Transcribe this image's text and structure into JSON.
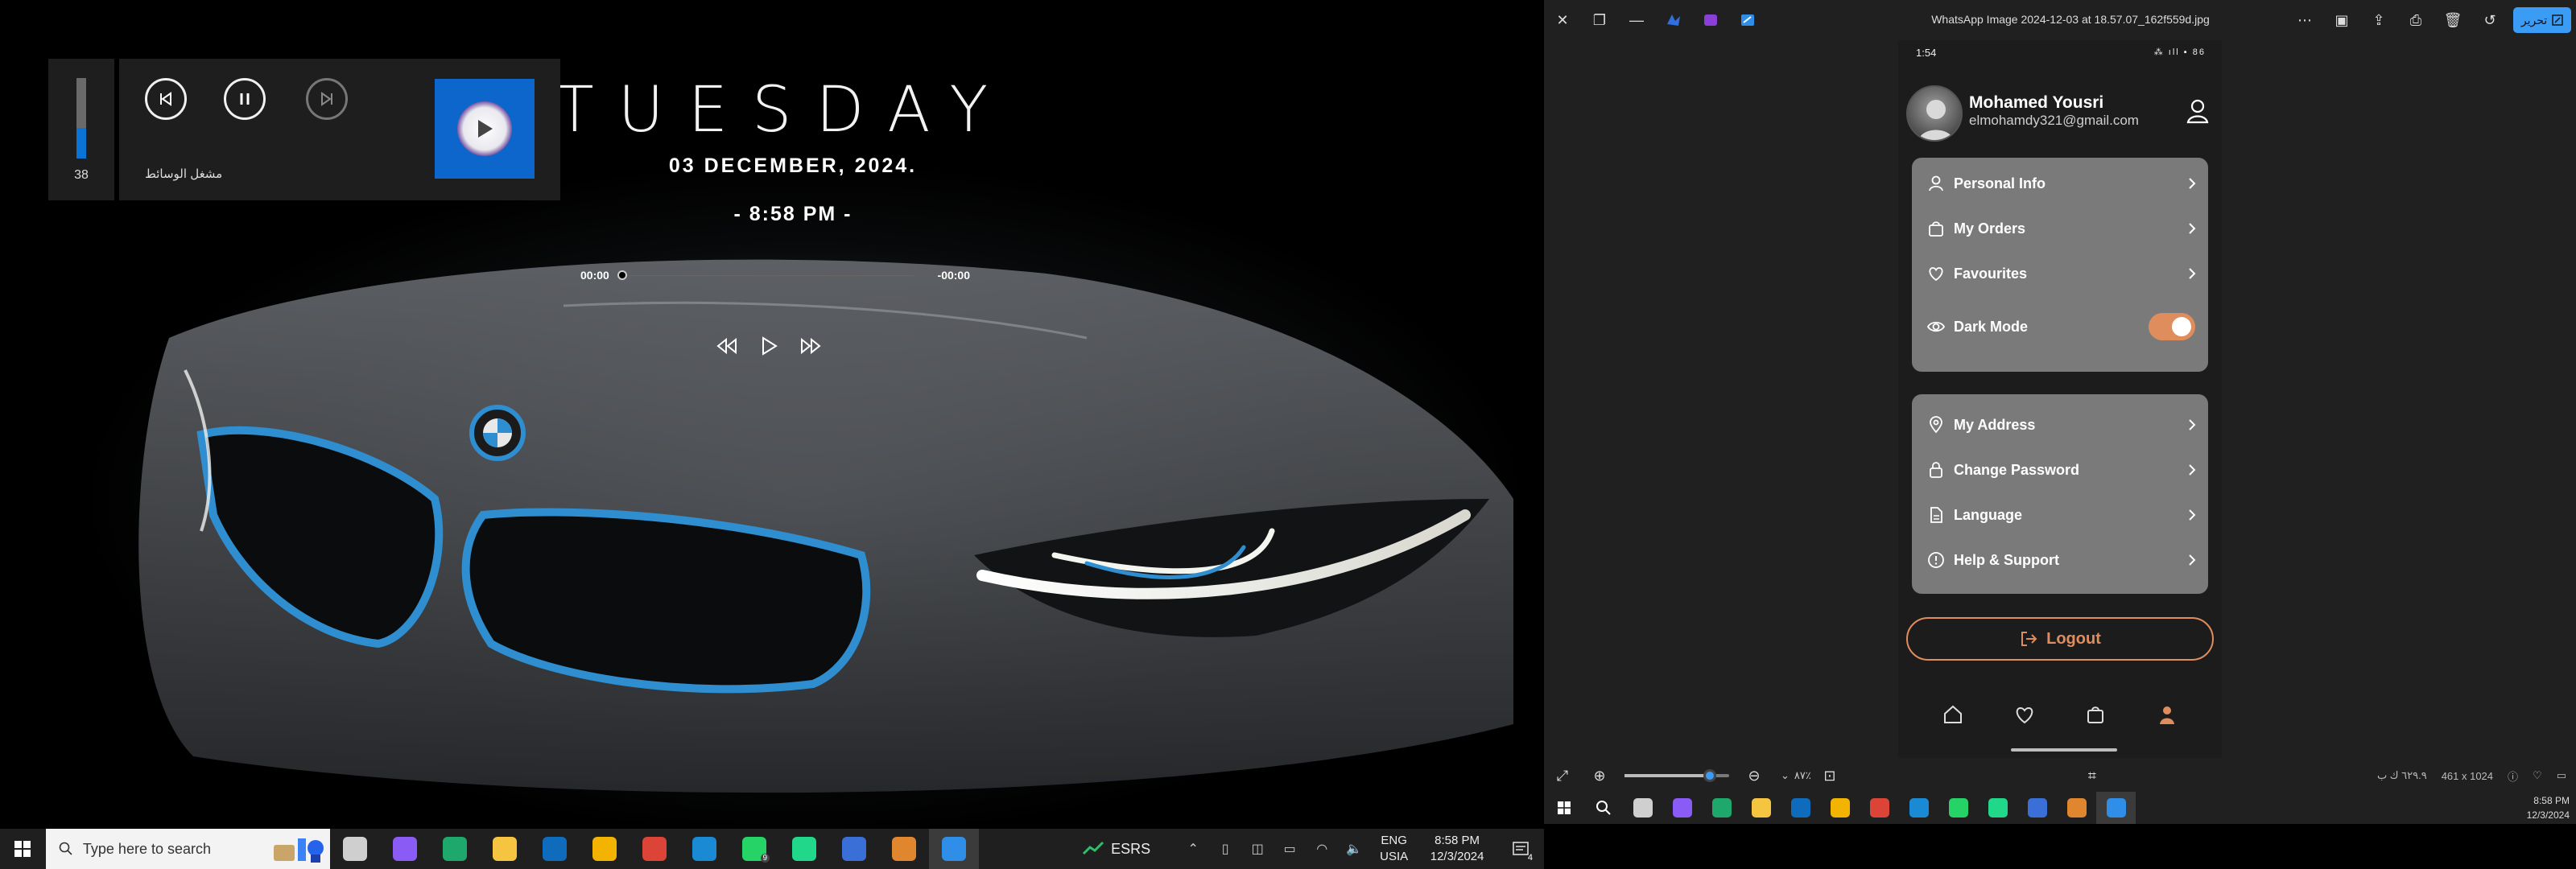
{
  "left_screen": {
    "clock": {
      "day": "TUESDAY",
      "date": "03 DECEMBER, 2024.",
      "time": "- 8:58 PM -"
    },
    "music_widget": {
      "elapsed": "00:00",
      "remaining": "-00:00",
      "progress": 0,
      "controls": [
        "rewind-icon",
        "play-icon",
        "fast-forward-icon"
      ]
    },
    "media_flyout": {
      "volume": "38",
      "volume_fraction": 0.38,
      "label": "مشغل الوسائط",
      "buttons": [
        "previous-icon",
        "pause-icon",
        "next-icon"
      ],
      "accent": "#0d66cc"
    },
    "taskbar": {
      "search_placeholder": "Type here to search",
      "apps": [
        {
          "name": "task-view",
          "color": "#cfcfcf",
          "badge": ""
        },
        {
          "name": "copilot",
          "color": "#8a5cf5",
          "badge": ""
        },
        {
          "name": "edge",
          "color": "#1fa86b",
          "badge": ""
        },
        {
          "name": "file-explorer",
          "color": "#f5c542",
          "badge": ""
        },
        {
          "name": "outlook",
          "color": "#0f6cbd",
          "badge": ""
        },
        {
          "name": "store",
          "color": "#f2b400",
          "badge": ""
        },
        {
          "name": "chrome",
          "color": "#db4437",
          "badge": ""
        },
        {
          "name": "vscode",
          "color": "#1a8ad4",
          "badge": ""
        },
        {
          "name": "whatsapp",
          "color": "#25d366",
          "badge": "9"
        },
        {
          "name": "pycharm",
          "color": "#21d789",
          "badge": ""
        },
        {
          "name": "app-blue",
          "color": "#3b6fd8",
          "badge": ""
        },
        {
          "name": "media-player",
          "color": "#e0862f",
          "badge": ""
        },
        {
          "name": "photos",
          "color": "#2f8fe8",
          "badge": ""
        }
      ],
      "weather": "ESRS",
      "lang_top": "ENG",
      "lang_bottom": "USIA",
      "time": "8:58 PM",
      "date": "12/3/2024",
      "notifications": "4"
    }
  },
  "right_screen": {
    "photos_app": {
      "file_title": "WhatsApp Image 2024-12-03 at 18.57.07_162f559d.jpg",
      "edit_label": "تحرير",
      "zoom": "٨٧٪",
      "file_size": "٦٢٩.٩ ك ب",
      "dimensions": "461 x 1024"
    },
    "phone": {
      "status_time": "1:54",
      "status_right": "⁂ ıll ▪ 86",
      "user_name": "Mohamed Yousri",
      "user_email": "elmohamdy321@gmail.com",
      "menu_group_1": [
        {
          "label": "Personal Info",
          "icon": "user-icon"
        },
        {
          "label": "My Orders",
          "icon": "bag-icon"
        },
        {
          "label": "Favourites",
          "icon": "heart-icon"
        },
        {
          "label": "Dark Mode",
          "icon": "eye-icon",
          "toggle": true
        }
      ],
      "menu_group_2": [
        {
          "label": "My Address",
          "icon": "location-icon"
        },
        {
          "label": "Change Password",
          "icon": "lock-icon"
        },
        {
          "label": "Language",
          "icon": "document-icon"
        },
        {
          "label": "Help & Support",
          "icon": "info-icon"
        }
      ],
      "logout_label": "Logout",
      "accent": "#e08d5d",
      "nav": [
        "home-icon",
        "heart-icon",
        "bag-icon",
        "profile-icon"
      ]
    },
    "taskbar": {
      "apps": [
        {
          "name": "search",
          "color": "#202020"
        },
        {
          "name": "task-view",
          "color": "#cfcfcf"
        },
        {
          "name": "copilot",
          "color": "#8a5cf5"
        },
        {
          "name": "edge",
          "color": "#1fa86b"
        },
        {
          "name": "file-explorer",
          "color": "#f5c542"
        },
        {
          "name": "outlook",
          "color": "#0f6cbd"
        },
        {
          "name": "store",
          "color": "#f2b400"
        },
        {
          "name": "chrome",
          "color": "#db4437"
        },
        {
          "name": "vscode",
          "color": "#1a8ad4"
        },
        {
          "name": "whatsapp",
          "color": "#25d366"
        },
        {
          "name": "app-green",
          "color": "#21d789"
        },
        {
          "name": "app-blue",
          "color": "#3b6fd8"
        },
        {
          "name": "media-player",
          "color": "#e0862f"
        },
        {
          "name": "photos",
          "color": "#2f8fe8"
        }
      ],
      "time": "8:58 PM",
      "date": "12/3/2024"
    }
  }
}
